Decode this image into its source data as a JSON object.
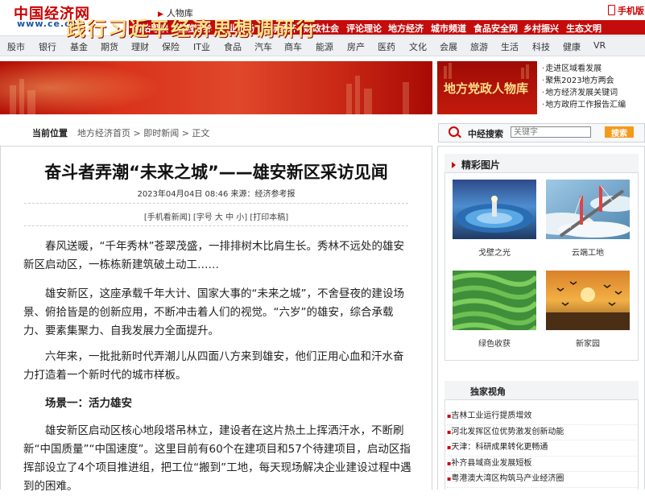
{
  "header": {
    "logo_cn": "中国经济网",
    "logo_url": "www.ce.cn",
    "people_link": "人物库",
    "mobile": "手机版",
    "channels": [
      "网站导读",
      "金融证券",
      "产业市场",
      "国际经济",
      "财政社会",
      "评论理论",
      "地方经济",
      "城市频道",
      "食品安全网",
      "乡村振兴",
      "生态文明"
    ]
  },
  "subnav": [
    "股市",
    "银行",
    "基金",
    "期货",
    "理财",
    "保险",
    "IT业",
    "食品",
    "汽车",
    "商车",
    "能源",
    "房产",
    "医药",
    "文化",
    "会展",
    "旅游",
    "生活",
    "科技",
    "健康",
    "VR"
  ],
  "banner": {
    "main_text": "践行习近平经济思想调研行",
    "side_text": "地方党政人物库"
  },
  "region_links": [
    "走进区域看发展",
    "聚焦2023地方两会",
    "地方经济发展关键词",
    "地方政府工作报告汇编"
  ],
  "breadcrumb": {
    "label": "当前位置",
    "path": "地方经济首页 > 即时新闻 > 正文"
  },
  "search": {
    "label": "中经搜索",
    "placeholder": "关键字",
    "button": "搜索"
  },
  "article": {
    "title": "奋斗者弄潮“未来之城”——雄安新区采访见闻",
    "meta": "2023年04月04日 08:46   来源：经济参考报",
    "tools": "[手机看新闻]  [字号 大 中 小]  [打印本稿]",
    "paragraphs": [
      "春风送暖，“千年秀林”苍翠茂盛，一排排树木比肩生长。秀林不远处的雄安新区启动区，一栋栋新建筑破土动工……",
      "雄安新区，这座承载千年大计、国家大事的“未来之城”，不舍昼夜的建设场景、俯拾皆是的创新应用，不断冲击着人们的视觉。“六岁”的雄安，综合承载力、要素集聚力、自我发展力全面提升。",
      "六年来，一批批新时代弄潮儿从四面八方来到雄安，他们正用心血和汗水奋力打造着一个新时代的城市样板。",
      "场景一：活力雄安",
      "雄安新区启动区核心地段塔吊林立，建设者在这片热土上挥洒汗水，不断刷新“中国质量”“中国速度”。这里目前有60个在建项目和57个待建项目，启动区指挥部设立了4个项目推进组，把工位“搬到”工地，每天现场解决企业建设过程中遇到的困难。"
    ]
  },
  "photos": {
    "title": "精彩图片",
    "items": [
      {
        "caption": "戈壁之光",
        "icon": "desert-solar-image"
      },
      {
        "caption": "云端工地",
        "icon": "bridge-clouds-image"
      },
      {
        "caption": "绿色收获",
        "icon": "tea-field-image"
      },
      {
        "caption": "新家园",
        "icon": "birds-sunset-image"
      }
    ]
  },
  "exclusive": {
    "title": "独家视角",
    "items": [
      "吉林工业运行提质增效",
      "河北发挥区位优势激发创新动能",
      "天津：科研成果转化更畅通",
      "补齐县域商业发展短板",
      "粤港澳大湾区构筑马产业经济圈"
    ]
  },
  "colors": {
    "brand_red": "#c40c0c",
    "link_blue": "#1a56a8",
    "search_orange": "#f39a1b"
  }
}
